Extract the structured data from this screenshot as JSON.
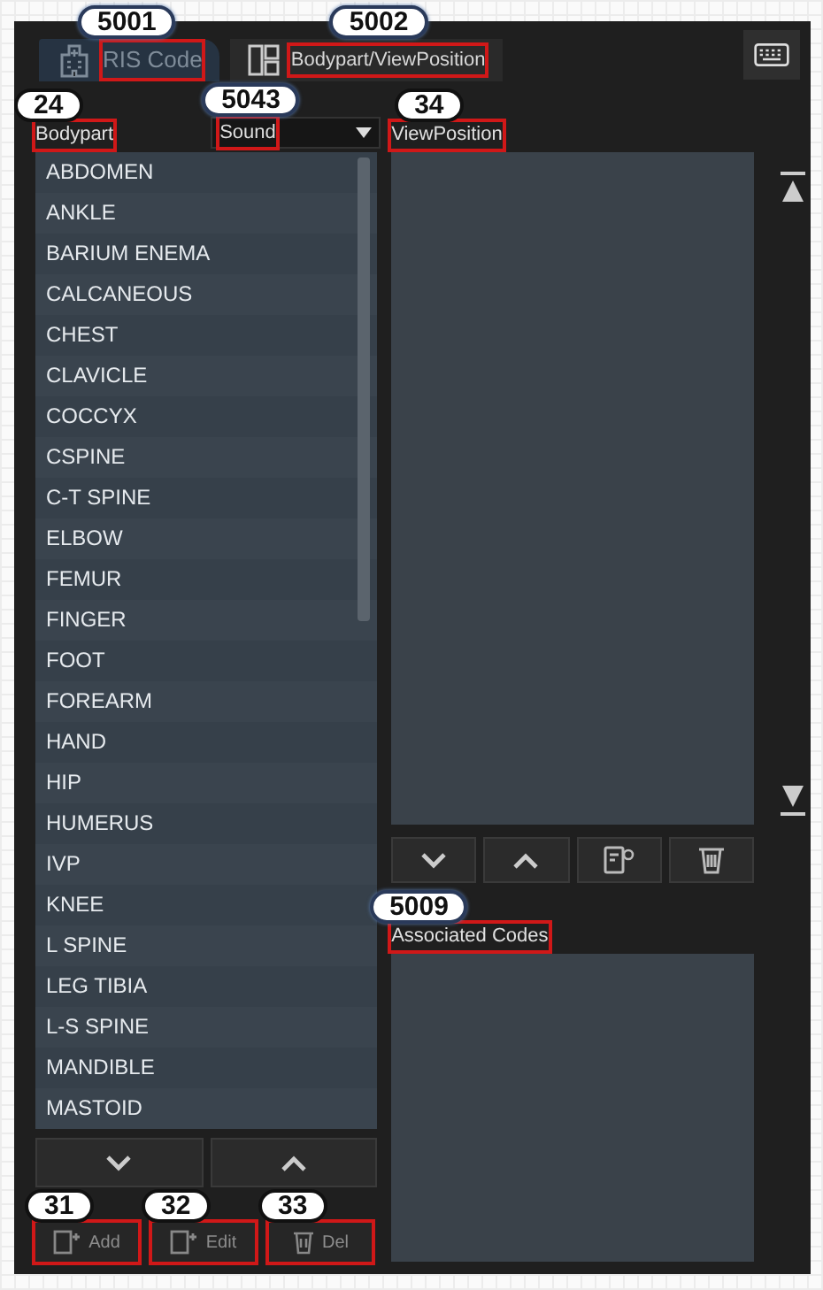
{
  "tabs": [
    {
      "label": "RIS Code",
      "selected": true,
      "callout": "5001"
    },
    {
      "label": "Bodypart/ViewPosition",
      "selected": false,
      "callout": "5002"
    }
  ],
  "bodypart": {
    "label": "Bodypart",
    "callout": "24",
    "items": [
      "ABDOMEN",
      "ANKLE",
      "BARIUM ENEMA",
      "CALCANEOUS",
      "CHEST",
      "CLAVICLE",
      "COCCYX",
      "CSPINE",
      "C-T SPINE",
      "ELBOW",
      "FEMUR",
      "FINGER",
      "FOOT",
      "FOREARM",
      "HAND",
      "HIP",
      "HUMERUS",
      "IVP",
      "KNEE",
      "L SPINE",
      "LEG TIBIA",
      "L-S SPINE",
      "MANDIBLE",
      "MASTOID"
    ]
  },
  "sound": {
    "value": "Sound",
    "callout": "5043"
  },
  "bodypart_buttons": [
    {
      "label": "Add",
      "kind": "add",
      "callout": "31"
    },
    {
      "label": "Edit",
      "kind": "edit",
      "callout": "32"
    },
    {
      "label": "Del",
      "kind": "delete",
      "callout": "33"
    }
  ],
  "view_position": {
    "label": "ViewPosition",
    "callout": "34"
  },
  "associated_codes": {
    "label": "Associated Codes",
    "callout": "5009"
  }
}
